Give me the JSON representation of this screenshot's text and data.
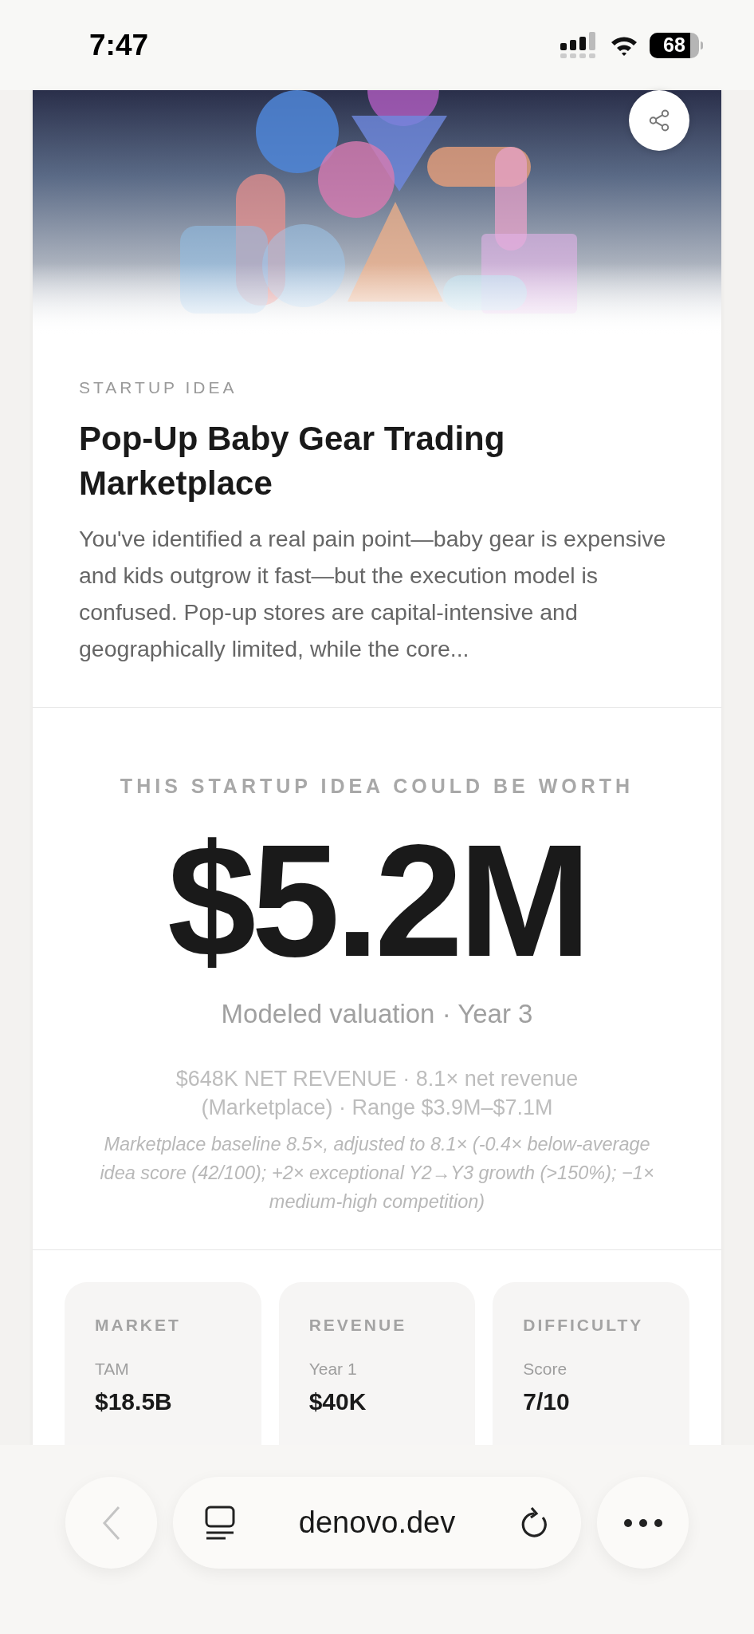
{
  "status_bar": {
    "time": "7:47",
    "battery": "68"
  },
  "idea": {
    "eyebrow": "STARTUP IDEA",
    "title": "Pop-Up Baby Gear Trading Marketplace",
    "description": "You've identified a real pain point—baby gear is expensive and kids outgrow it fast—but the execution model is confused. Pop-up stores are capital-intensive and geographically limited, while the core..."
  },
  "valuation": {
    "eyebrow": "THIS STARTUP IDEA COULD BE WORTH",
    "value": "$5.2M",
    "subtitle": "Modeled valuation · Year 3",
    "details": "$648K NET REVENUE · 8.1× net revenue (Marketplace) · Range $3.9M–$7.1M",
    "note": "Marketplace baseline 8.5×, adjusted to 8.1× (-0.4× below-average idea score (42/100); +2× exceptional Y2→Y3 growth (>150%); −1× medium-high competition)"
  },
  "metrics": [
    {
      "title": "MARKET",
      "label": "TAM",
      "value": "$18.5B"
    },
    {
      "title": "REVENUE",
      "label": "Year 1",
      "value": "$40K"
    },
    {
      "title": "DIFFICULTY",
      "label": "Score",
      "value": "7/10"
    }
  ],
  "browser": {
    "url": "denovo.dev",
    "back_disabled": true
  }
}
